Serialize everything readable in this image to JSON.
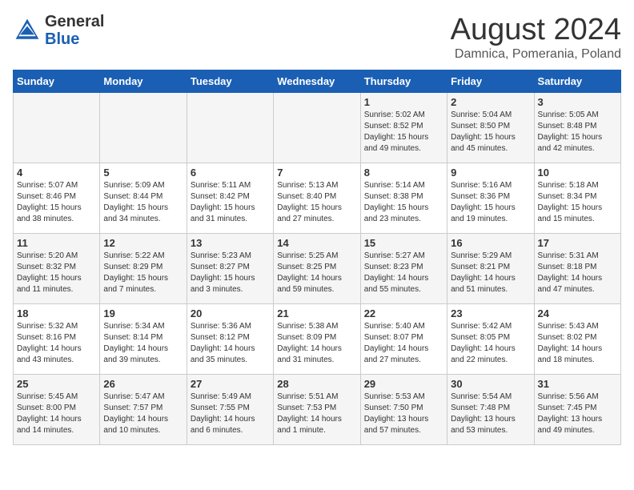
{
  "logo": {
    "text_general": "General",
    "text_blue": "Blue"
  },
  "header": {
    "month_year": "August 2024",
    "location": "Damnica, Pomerania, Poland"
  },
  "days_of_week": [
    "Sunday",
    "Monday",
    "Tuesday",
    "Wednesday",
    "Thursday",
    "Friday",
    "Saturday"
  ],
  "weeks": [
    {
      "days": [
        {
          "num": "",
          "info": ""
        },
        {
          "num": "",
          "info": ""
        },
        {
          "num": "",
          "info": ""
        },
        {
          "num": "",
          "info": ""
        },
        {
          "num": "1",
          "info": "Sunrise: 5:02 AM\nSunset: 8:52 PM\nDaylight: 15 hours\nand 49 minutes."
        },
        {
          "num": "2",
          "info": "Sunrise: 5:04 AM\nSunset: 8:50 PM\nDaylight: 15 hours\nand 45 minutes."
        },
        {
          "num": "3",
          "info": "Sunrise: 5:05 AM\nSunset: 8:48 PM\nDaylight: 15 hours\nand 42 minutes."
        }
      ]
    },
    {
      "days": [
        {
          "num": "4",
          "info": "Sunrise: 5:07 AM\nSunset: 8:46 PM\nDaylight: 15 hours\nand 38 minutes."
        },
        {
          "num": "5",
          "info": "Sunrise: 5:09 AM\nSunset: 8:44 PM\nDaylight: 15 hours\nand 34 minutes."
        },
        {
          "num": "6",
          "info": "Sunrise: 5:11 AM\nSunset: 8:42 PM\nDaylight: 15 hours\nand 31 minutes."
        },
        {
          "num": "7",
          "info": "Sunrise: 5:13 AM\nSunset: 8:40 PM\nDaylight: 15 hours\nand 27 minutes."
        },
        {
          "num": "8",
          "info": "Sunrise: 5:14 AM\nSunset: 8:38 PM\nDaylight: 15 hours\nand 23 minutes."
        },
        {
          "num": "9",
          "info": "Sunrise: 5:16 AM\nSunset: 8:36 PM\nDaylight: 15 hours\nand 19 minutes."
        },
        {
          "num": "10",
          "info": "Sunrise: 5:18 AM\nSunset: 8:34 PM\nDaylight: 15 hours\nand 15 minutes."
        }
      ]
    },
    {
      "days": [
        {
          "num": "11",
          "info": "Sunrise: 5:20 AM\nSunset: 8:32 PM\nDaylight: 15 hours\nand 11 minutes."
        },
        {
          "num": "12",
          "info": "Sunrise: 5:22 AM\nSunset: 8:29 PM\nDaylight: 15 hours\nand 7 minutes."
        },
        {
          "num": "13",
          "info": "Sunrise: 5:23 AM\nSunset: 8:27 PM\nDaylight: 15 hours\nand 3 minutes."
        },
        {
          "num": "14",
          "info": "Sunrise: 5:25 AM\nSunset: 8:25 PM\nDaylight: 14 hours\nand 59 minutes."
        },
        {
          "num": "15",
          "info": "Sunrise: 5:27 AM\nSunset: 8:23 PM\nDaylight: 14 hours\nand 55 minutes."
        },
        {
          "num": "16",
          "info": "Sunrise: 5:29 AM\nSunset: 8:21 PM\nDaylight: 14 hours\nand 51 minutes."
        },
        {
          "num": "17",
          "info": "Sunrise: 5:31 AM\nSunset: 8:18 PM\nDaylight: 14 hours\nand 47 minutes."
        }
      ]
    },
    {
      "days": [
        {
          "num": "18",
          "info": "Sunrise: 5:32 AM\nSunset: 8:16 PM\nDaylight: 14 hours\nand 43 minutes."
        },
        {
          "num": "19",
          "info": "Sunrise: 5:34 AM\nSunset: 8:14 PM\nDaylight: 14 hours\nand 39 minutes."
        },
        {
          "num": "20",
          "info": "Sunrise: 5:36 AM\nSunset: 8:12 PM\nDaylight: 14 hours\nand 35 minutes."
        },
        {
          "num": "21",
          "info": "Sunrise: 5:38 AM\nSunset: 8:09 PM\nDaylight: 14 hours\nand 31 minutes."
        },
        {
          "num": "22",
          "info": "Sunrise: 5:40 AM\nSunset: 8:07 PM\nDaylight: 14 hours\nand 27 minutes."
        },
        {
          "num": "23",
          "info": "Sunrise: 5:42 AM\nSunset: 8:05 PM\nDaylight: 14 hours\nand 22 minutes."
        },
        {
          "num": "24",
          "info": "Sunrise: 5:43 AM\nSunset: 8:02 PM\nDaylight: 14 hours\nand 18 minutes."
        }
      ]
    },
    {
      "days": [
        {
          "num": "25",
          "info": "Sunrise: 5:45 AM\nSunset: 8:00 PM\nDaylight: 14 hours\nand 14 minutes."
        },
        {
          "num": "26",
          "info": "Sunrise: 5:47 AM\nSunset: 7:57 PM\nDaylight: 14 hours\nand 10 minutes."
        },
        {
          "num": "27",
          "info": "Sunrise: 5:49 AM\nSunset: 7:55 PM\nDaylight: 14 hours\nand 6 minutes."
        },
        {
          "num": "28",
          "info": "Sunrise: 5:51 AM\nSunset: 7:53 PM\nDaylight: 14 hours\nand 1 minute."
        },
        {
          "num": "29",
          "info": "Sunrise: 5:53 AM\nSunset: 7:50 PM\nDaylight: 13 hours\nand 57 minutes."
        },
        {
          "num": "30",
          "info": "Sunrise: 5:54 AM\nSunset: 7:48 PM\nDaylight: 13 hours\nand 53 minutes."
        },
        {
          "num": "31",
          "info": "Sunrise: 5:56 AM\nSunset: 7:45 PM\nDaylight: 13 hours\nand 49 minutes."
        }
      ]
    }
  ]
}
